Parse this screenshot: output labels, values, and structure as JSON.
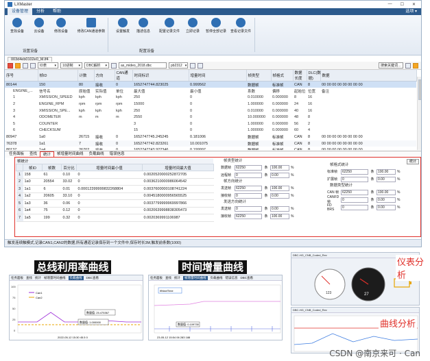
{
  "window": {
    "title": "LXMaster",
    "controls": [
      "—",
      "☐",
      "✕"
    ]
  },
  "menu": {
    "items": [
      "设备管理",
      "分析",
      "帮助"
    ],
    "active": 0,
    "right": "选项 ▾"
  },
  "ribbon": {
    "buttons": [
      {
        "label": "查找设备"
      },
      {
        "label": "云设备"
      },
      {
        "label": "修改设备"
      },
      {
        "label": "修改CAN通道参数"
      },
      {
        "label": "设置触发"
      },
      {
        "label": "描述信息"
      },
      {
        "label": "配置记录文件"
      },
      {
        "label": "立即记录"
      },
      {
        "label": "暂停全部记录"
      },
      {
        "label": "查看记录文件"
      }
    ],
    "groups": [
      "设置设备",
      "配置设备"
    ]
  },
  "file_tab": "003d4eb0102e0_M.lf4",
  "toolbar": {
    "view_select": "ID表",
    "radix_select": "10进制",
    "dbc_label": "DBC解析",
    "dbc_file": "as_mideo_2018.dbc",
    "dbc_ch": "pb2312",
    "search_placeholder": "搜索关键词…"
  },
  "grid": {
    "headers": [
      "序号",
      "帧ID",
      "计数",
      "方向",
      "CAN通道",
      "时间标识",
      "增量时间",
      "帧类型",
      "帧格式",
      "数据长度",
      "DLC(数据)",
      "数据"
    ],
    "rows": [
      {
        "cls": "main",
        "c": [
          "80144",
          "150",
          "80",
          "接收",
          "0",
          "1652747744.823025",
          "0.999562",
          "数据帧",
          "标准帧",
          "CAN",
          "8",
          "00 00 00 00 00 00 00 00"
        ]
      },
      {
        "cls": "sub",
        "c": [
          "ENGINE_...",
          "信号名",
          "原始值",
          "实际值",
          "单位",
          "最大值",
          "最小值",
          "系数",
          "偏移",
          "起始位",
          "位宽",
          "备注"
        ]
      },
      {
        "cls": "sub",
        "c": [
          "1",
          "XMISSION_SPEED",
          "kph",
          "kph",
          "kph",
          "250",
          "0",
          "0.010000",
          "0.000000",
          "8",
          "16",
          ""
        ]
      },
      {
        "cls": "sub",
        "c": [
          "2",
          "ENGINE_RPM",
          "rpm",
          "rpm",
          "rpm",
          "15000",
          "0",
          "1.000000",
          "0.000000",
          "24",
          "16",
          ""
        ]
      },
      {
        "cls": "sub",
        "c": [
          "3",
          "XMISSION_SPE...",
          "kph",
          "kph",
          "kph",
          "250",
          "0",
          "0.010000",
          "0.000000",
          "40",
          "16",
          ""
        ]
      },
      {
        "cls": "sub",
        "c": [
          "4",
          "ODOMETER",
          "m",
          "m",
          "m",
          "2550",
          "0",
          "10.000000",
          "0.000000",
          "48",
          "8",
          ""
        ]
      },
      {
        "cls": "sub",
        "c": [
          "5",
          "COUNTER",
          "",
          "",
          "",
          "3",
          "0",
          "1.000000",
          "0.000000",
          "56",
          "2",
          ""
        ]
      },
      {
        "cls": "sub",
        "c": [
          "6",
          "CHECKSUM",
          "",
          "",
          "",
          "15",
          "0",
          "1.000000",
          "0.000000",
          "60",
          "4",
          ""
        ]
      },
      {
        "cls": "main",
        "c": [
          "80947",
          "1a0",
          "26715",
          "接收",
          "0",
          "1652747745.245245",
          "0.181006",
          "数据帧",
          "标准帧",
          "CAN",
          "8",
          "00 00 00 00 00 00 00 00"
        ]
      },
      {
        "cls": "main",
        "c": [
          "76378",
          "1a1",
          "7",
          "接收",
          "0",
          "1652747742.823261",
          "10.001075",
          "数据帧",
          "标准帧",
          "CAN",
          "8",
          "00 00 00 00 00 00 00 00"
        ]
      },
      {
        "cls": "main",
        "c": [
          "80137",
          "1a4",
          "26702",
          "接收",
          "0",
          "1652747743.922346",
          "0.199997",
          "数据帧",
          "标准帧",
          "CAN",
          "8",
          "00 00 00 00 00 00 00 00"
        ]
      }
    ]
  },
  "bottom_tabs": {
    "items": [
      "任务面板",
      "查找",
      "统计",
      "帧增量时间曲线",
      "负载曲线",
      "错误信息"
    ],
    "active": 2
  },
  "frame_stats": {
    "title": "帧统计",
    "headers": [
      "帧ID",
      "帧数",
      "百分比",
      "增量时间最小值",
      "增量时间最大值"
    ],
    "rows": [
      [
        "158",
        "61",
        "0.10",
        "0",
        "0.0020520000252872705"
      ],
      [
        "1a0",
        "20554",
        "33.02",
        "0",
        "0.0036210000986064542"
      ],
      [
        "1a1",
        "6",
        "0.01",
        "0.00012399999832268804",
        "0.0037600000108741224"
      ],
      [
        "1a2",
        "20605",
        "33.10",
        "0",
        "0.0045180000956565525"
      ],
      [
        "1a3",
        "36",
        "0.06",
        "0",
        "0.0037799999969997866"
      ],
      [
        "1a4",
        "75",
        "0.12",
        "0",
        "0.0020639998838305473"
      ],
      [
        "1a5",
        "199",
        "0.32",
        "0",
        "0.0020369991106987"
      ]
    ]
  },
  "type_stats": {
    "title": "帧类型统计",
    "rows": [
      {
        "label": "数据帧",
        "value": "62250",
        "unit": "条",
        "pct": "100.00",
        "sign": "%"
      },
      {
        "label": "远程帧",
        "value": "0",
        "unit": "条",
        "pct": "0.00",
        "sign": "%"
      }
    ],
    "dir_title": "帧方向统计",
    "dir_rows": [
      {
        "label": "发送帧",
        "value": "62250",
        "unit": "条",
        "pct": "100.00",
        "sign": "%"
      },
      {
        "label": "接收帧",
        "value": "0",
        "unit": "条",
        "pct": "0.00",
        "sign": "%"
      }
    ],
    "txrx_title": "发送方向统计",
    "txrx_rows": [
      {
        "label": "发送帧",
        "value": "0",
        "unit": "条",
        "pct": "0.00",
        "sign": "%"
      },
      {
        "label": "接收帧",
        "value": "62250",
        "unit": "条",
        "pct": "100.00",
        "sign": "%"
      }
    ]
  },
  "format_stats": {
    "button": "统计",
    "title": "帧格式统计",
    "rows": [
      {
        "label": "标准帧",
        "value": "62250",
        "unit": "条",
        "pct": "100.00",
        "sign": "%"
      },
      {
        "label": "扩展帧",
        "value": "0",
        "unit": "条",
        "pct": "0.00",
        "sign": "%"
      }
    ],
    "proto_title": "数据类型统计",
    "proto_rows": [
      {
        "label": "CAN 帧",
        "value": "62250",
        "unit": "条",
        "pct": "100.00",
        "sign": "%"
      },
      {
        "label": "CANFD 帧",
        "value": "0",
        "unit": "条",
        "pct": "0.00",
        "sign": "%"
      },
      {
        "label": "FD BRS",
        "value": "0",
        "unit": "条",
        "pct": "0.00",
        "sign": "%"
      }
    ]
  },
  "statusbar": "触发连续触模式,记录CAN1,CAN2的数据,所有通道记录保存到一个文件中,保存时长3M,触发前条数(1000)",
  "captions": {
    "bus": "总线利用率曲线",
    "time": "时间增量曲线",
    "meter": "仪表分析",
    "curve": "曲线分析"
  },
  "thumb_bus": {
    "tabs": [
      "任务面板",
      "查找",
      "统计",
      "帧增量时间曲线",
      "负载曲线",
      "DBC查看"
    ],
    "legend": [
      "Can1",
      "Can2"
    ],
    "tooltip": "数量值: 25.475367",
    "tooltip2": "数量值: 1.000000",
    "footer": "2022-05-12 15:30 45.5 0"
  },
  "thumb_time": {
    "tabs": [
      "任务面板",
      "查找",
      "统计",
      "帧增量时间曲线",
      "负载曲线",
      "错误信息",
      "DBC查看"
    ],
    "legend": "IfMaxtTime",
    "tooltip": "数量值: 0.109730",
    "footer": "23-05-12 15:54 06 283 188"
  },
  "thumb_meter": {
    "title": "DBC-HG_CNB_Coded_Rev",
    "speed": "27",
    "left": "123"
  },
  "thumb_curve": {
    "title": "DBC-HG_CNB_Coded_Rev"
  },
  "watermark": "CSDN @南京来可 · Can"
}
